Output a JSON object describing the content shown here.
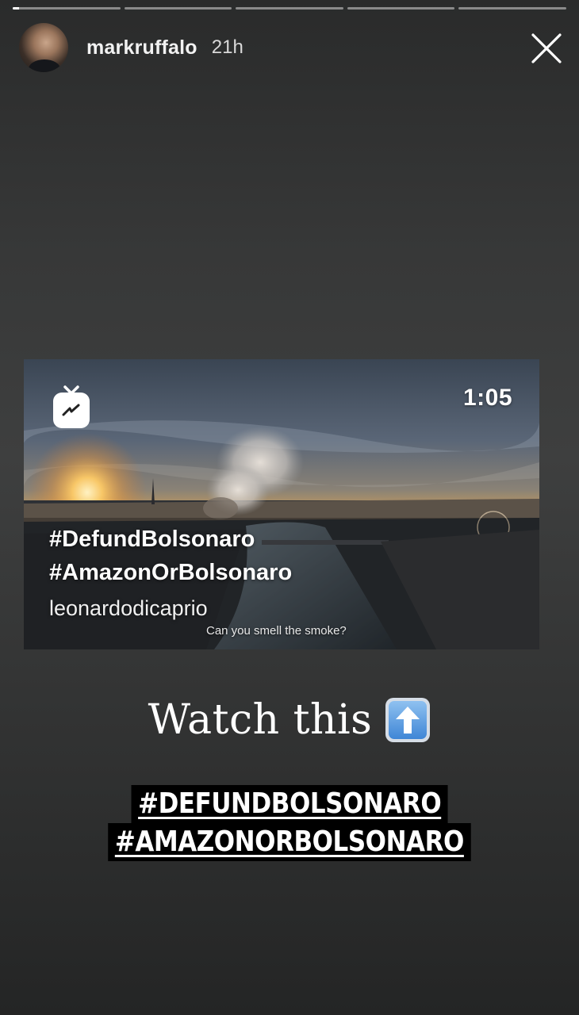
{
  "progress": {
    "segments": [
      0.06,
      0,
      0,
      0,
      0
    ]
  },
  "header": {
    "username": "markruffalo",
    "time": "21h",
    "avatar_icon": "profile-avatar",
    "close_icon": "close-icon"
  },
  "igtv_card": {
    "icon": "igtv-icon",
    "duration": "1:05",
    "tags": [
      "#DefundBolsonaro",
      "#AmazonOrBolsonaro"
    ],
    "author": "leonardodicaprio",
    "caption": "Can you smell the smoke?"
  },
  "story": {
    "watch_text": "Watch this",
    "arrow_icon": "up-arrow-emoji-icon",
    "hashtags": [
      "#DEFUNDBOLSONARO",
      "#AMAZONORBOLSONARO"
    ]
  }
}
